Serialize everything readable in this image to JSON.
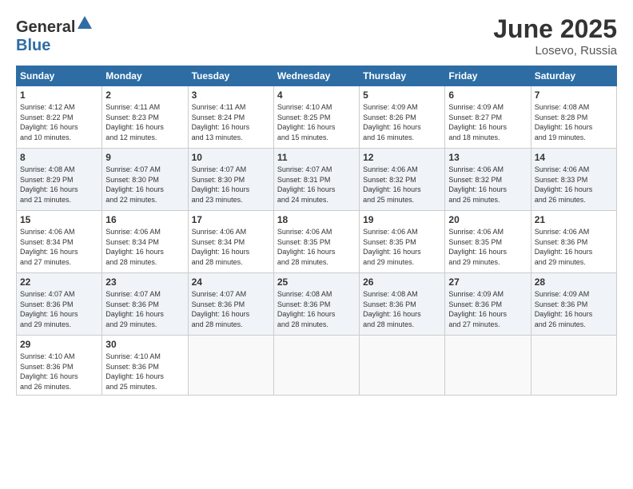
{
  "header": {
    "logo_general": "General",
    "logo_blue": "Blue",
    "month": "June 2025",
    "location": "Losevo, Russia"
  },
  "weekdays": [
    "Sunday",
    "Monday",
    "Tuesday",
    "Wednesday",
    "Thursday",
    "Friday",
    "Saturday"
  ],
  "weeks": [
    [
      {
        "day": "1",
        "sunrise": "4:12 AM",
        "sunset": "8:22 PM",
        "daylight": "16 hours and 10 minutes."
      },
      {
        "day": "2",
        "sunrise": "4:11 AM",
        "sunset": "8:23 PM",
        "daylight": "16 hours and 12 minutes."
      },
      {
        "day": "3",
        "sunrise": "4:11 AM",
        "sunset": "8:24 PM",
        "daylight": "16 hours and 13 minutes."
      },
      {
        "day": "4",
        "sunrise": "4:10 AM",
        "sunset": "8:25 PM",
        "daylight": "16 hours and 15 minutes."
      },
      {
        "day": "5",
        "sunrise": "4:09 AM",
        "sunset": "8:26 PM",
        "daylight": "16 hours and 16 minutes."
      },
      {
        "day": "6",
        "sunrise": "4:09 AM",
        "sunset": "8:27 PM",
        "daylight": "16 hours and 18 minutes."
      },
      {
        "day": "7",
        "sunrise": "4:08 AM",
        "sunset": "8:28 PM",
        "daylight": "16 hours and 19 minutes."
      }
    ],
    [
      {
        "day": "8",
        "sunrise": "4:08 AM",
        "sunset": "8:29 PM",
        "daylight": "16 hours and 21 minutes."
      },
      {
        "day": "9",
        "sunrise": "4:07 AM",
        "sunset": "8:30 PM",
        "daylight": "16 hours and 22 minutes."
      },
      {
        "day": "10",
        "sunrise": "4:07 AM",
        "sunset": "8:30 PM",
        "daylight": "16 hours and 23 minutes."
      },
      {
        "day": "11",
        "sunrise": "4:07 AM",
        "sunset": "8:31 PM",
        "daylight": "16 hours and 24 minutes."
      },
      {
        "day": "12",
        "sunrise": "4:06 AM",
        "sunset": "8:32 PM",
        "daylight": "16 hours and 25 minutes."
      },
      {
        "day": "13",
        "sunrise": "4:06 AM",
        "sunset": "8:32 PM",
        "daylight": "16 hours and 26 minutes."
      },
      {
        "day": "14",
        "sunrise": "4:06 AM",
        "sunset": "8:33 PM",
        "daylight": "16 hours and 26 minutes."
      }
    ],
    [
      {
        "day": "15",
        "sunrise": "4:06 AM",
        "sunset": "8:34 PM",
        "daylight": "16 hours and 27 minutes."
      },
      {
        "day": "16",
        "sunrise": "4:06 AM",
        "sunset": "8:34 PM",
        "daylight": "16 hours and 28 minutes."
      },
      {
        "day": "17",
        "sunrise": "4:06 AM",
        "sunset": "8:34 PM",
        "daylight": "16 hours and 28 minutes."
      },
      {
        "day": "18",
        "sunrise": "4:06 AM",
        "sunset": "8:35 PM",
        "daylight": "16 hours and 28 minutes."
      },
      {
        "day": "19",
        "sunrise": "4:06 AM",
        "sunset": "8:35 PM",
        "daylight": "16 hours and 29 minutes."
      },
      {
        "day": "20",
        "sunrise": "4:06 AM",
        "sunset": "8:35 PM",
        "daylight": "16 hours and 29 minutes."
      },
      {
        "day": "21",
        "sunrise": "4:06 AM",
        "sunset": "8:36 PM",
        "daylight": "16 hours and 29 minutes."
      }
    ],
    [
      {
        "day": "22",
        "sunrise": "4:07 AM",
        "sunset": "8:36 PM",
        "daylight": "16 hours and 29 minutes."
      },
      {
        "day": "23",
        "sunrise": "4:07 AM",
        "sunset": "8:36 PM",
        "daylight": "16 hours and 29 minutes."
      },
      {
        "day": "24",
        "sunrise": "4:07 AM",
        "sunset": "8:36 PM",
        "daylight": "16 hours and 28 minutes."
      },
      {
        "day": "25",
        "sunrise": "4:08 AM",
        "sunset": "8:36 PM",
        "daylight": "16 hours and 28 minutes."
      },
      {
        "day": "26",
        "sunrise": "4:08 AM",
        "sunset": "8:36 PM",
        "daylight": "16 hours and 28 minutes."
      },
      {
        "day": "27",
        "sunrise": "4:09 AM",
        "sunset": "8:36 PM",
        "daylight": "16 hours and 27 minutes."
      },
      {
        "day": "28",
        "sunrise": "4:09 AM",
        "sunset": "8:36 PM",
        "daylight": "16 hours and 26 minutes."
      }
    ],
    [
      {
        "day": "29",
        "sunrise": "4:10 AM",
        "sunset": "8:36 PM",
        "daylight": "16 hours and 26 minutes."
      },
      {
        "day": "30",
        "sunrise": "4:10 AM",
        "sunset": "8:36 PM",
        "daylight": "16 hours and 25 minutes."
      },
      null,
      null,
      null,
      null,
      null
    ]
  ]
}
